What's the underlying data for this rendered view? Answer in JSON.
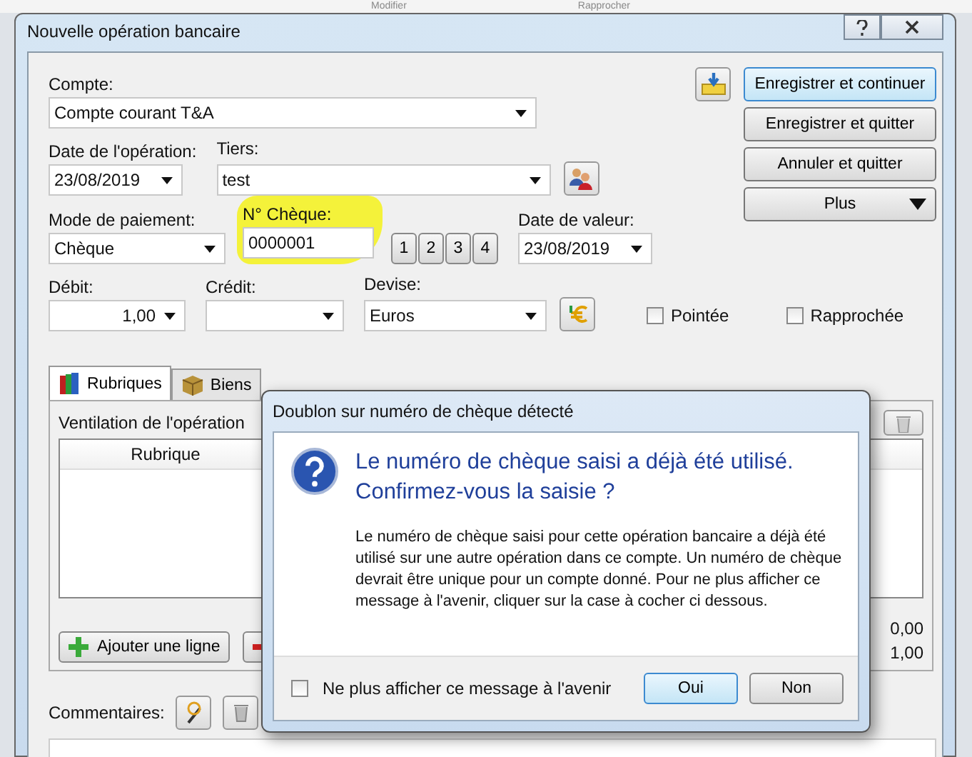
{
  "background_toolbar": [
    "Modifier",
    "Rapprocher"
  ],
  "window": {
    "title": "Nouvelle opération bancaire"
  },
  "form": {
    "account": {
      "label": "Compte:",
      "value": "Compte courant T&A"
    },
    "date": {
      "label": "Date de l'opération:",
      "value": "23/08/2019"
    },
    "payee": {
      "label": "Tiers:",
      "value": "test"
    },
    "payment_mode": {
      "label": "Mode de paiement:",
      "value": "Chèque"
    },
    "cheque_number": {
      "label": "N° Chèque:",
      "value": "0000001"
    },
    "number_buttons": [
      "1",
      "2",
      "3",
      "4"
    ],
    "value_date": {
      "label": "Date de valeur:",
      "value": "23/08/2019"
    },
    "debit": {
      "label": "Débit:",
      "value": "1,00"
    },
    "credit": {
      "label": "Crédit:"
    },
    "currency": {
      "label": "Devise:",
      "value": "Euros"
    },
    "checkboxes": [
      {
        "label": "Pointée",
        "checked": false
      },
      {
        "label": "Rapprochée",
        "checked": false
      }
    ]
  },
  "actions": [
    {
      "label": "Enregistrer et continuer",
      "kind": "default"
    },
    {
      "label": "Enregistrer et quitter",
      "kind": "plain"
    },
    {
      "label": "Annuler et quitter",
      "kind": "plain"
    },
    {
      "label": "Plus",
      "kind": "menu"
    }
  ],
  "tabs": [
    {
      "label": "Rubriques",
      "selected": true
    },
    {
      "label": "Biens",
      "selected": false
    }
  ],
  "breakdown": {
    "caption": "Ventilation de l'opération",
    "columns": [
      "Rubrique"
    ],
    "add_button": "Ajouter une ligne",
    "totals": [
      "0,00",
      "1,00"
    ]
  },
  "comments": {
    "label": "Commentaires:"
  },
  "dialog": {
    "title": "Doublon sur numéro de chèque détecté",
    "heading_lines": [
      "Le numéro de chèque saisi a déjà été utilisé.",
      "Confirmez-vous la saisie ?"
    ],
    "message": "Le numéro de chèque saisi pour cette opération bancaire a déjà été utilisé sur une autre opération dans ce compte. Un numéro de chèque devrait être unique pour un compte donné. Pour ne plus afficher ce message à l'avenir, cliquer sur la case à cocher ci dessous.",
    "dont_show": {
      "label": "Ne plus afficher ce message à l'avenir",
      "checked": false
    },
    "buttons": [
      {
        "label": "Oui",
        "kind": "default"
      },
      {
        "label": "Non",
        "kind": "plain"
      }
    ]
  }
}
